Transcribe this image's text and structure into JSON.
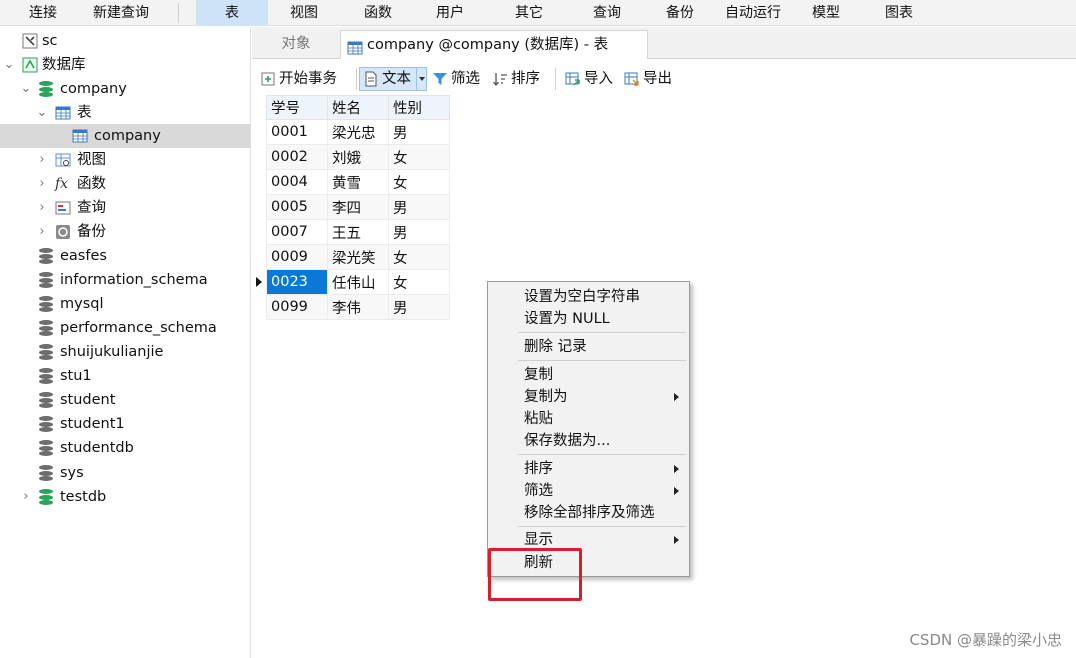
{
  "menu": [
    "连接",
    "新建查询",
    "表",
    "视图",
    "函数",
    "用户",
    "其它",
    "查询",
    "备份",
    "自动运行",
    "模型",
    "图表"
  ],
  "tree": {
    "sc": "sc",
    "root": "数据库",
    "company": "company",
    "tables": "表",
    "table_company": "company",
    "views": "视图",
    "functions": "函数",
    "functions_icon_text": "fx",
    "queries": "查询",
    "backups": "备份",
    "dbs": [
      "easfes",
      "information_schema",
      "mysql",
      "performance_schema",
      "shuijukulianjie",
      "stu1",
      "student",
      "student1",
      "studentdb",
      "sys"
    ],
    "testdb": "testdb"
  },
  "tabs": {
    "objects": "对象",
    "current": "company @company (数据库) - 表"
  },
  "toolbar": {
    "begin_tx": "开始事务",
    "text": "文本",
    "filter": "筛选",
    "sort": "排序",
    "import": "导入",
    "export": "导出"
  },
  "grid": {
    "columns": [
      "学号",
      "姓名",
      "性别"
    ],
    "rows": [
      [
        "0001",
        "梁光忠",
        "男"
      ],
      [
        "0002",
        "刘娥",
        "女"
      ],
      [
        "0004",
        "黄雪",
        "女"
      ],
      [
        "0005",
        "李四",
        "男"
      ],
      [
        "0007",
        "王五",
        "男"
      ],
      [
        "0009",
        "梁光笑",
        "女"
      ],
      [
        "0023",
        "任伟山",
        "女"
      ],
      [
        "0099",
        "李伟",
        "男"
      ]
    ],
    "selected_row": 6
  },
  "context_menu": {
    "set_empty": "设置为空白字符串",
    "set_null": "设置为 NULL",
    "delete": "删除 记录",
    "copy": "复制",
    "copy_as": "复制为",
    "paste": "粘贴",
    "save_as": "保存数据为...",
    "sort": "排序",
    "filter": "筛选",
    "remove_all": "移除全部排序及筛选",
    "display": "显示",
    "refresh": "刷新"
  },
  "watermark": "CSDN @暴躁的梁小忠",
  "colors": {
    "selection": "#0a78d7",
    "highlight_box": "#d4202a",
    "active_menu": "#cde3f7"
  }
}
